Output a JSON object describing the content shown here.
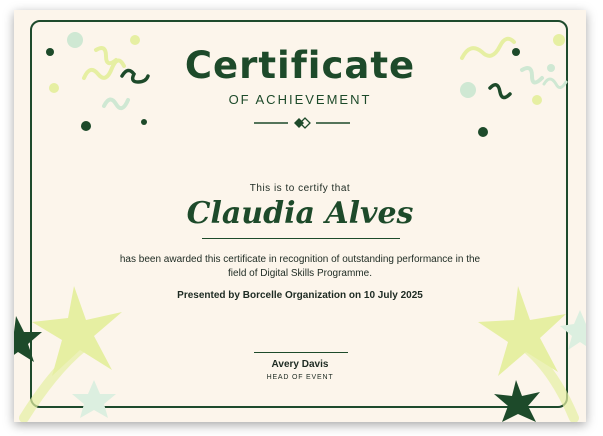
{
  "certificate": {
    "title": "Certificate",
    "subtitle": "OF ACHIEVEMENT",
    "certify_text": "This is to certify that",
    "recipient_name": "Claudia Alves",
    "body_line_1": "has been awarded this certificate in recognition of outstanding performance in the",
    "body_line_2": "field of Digital Skills Programme.",
    "presented_by": "Presented by Borcelle Organization on 10 July 2025",
    "signer_name": "Avery Davis",
    "signer_title": "HEAD OF EVENT"
  },
  "colors": {
    "background": "#fcf5eb",
    "primary_green": "#1d4a2a",
    "lime_accent": "#e6efa2",
    "mint_accent": "#cfe8d3"
  },
  "decorations": {
    "confetti_icon": "confetti-icon",
    "star_icon": "star-icon",
    "divider_icon": "diamond-divider-icon"
  }
}
